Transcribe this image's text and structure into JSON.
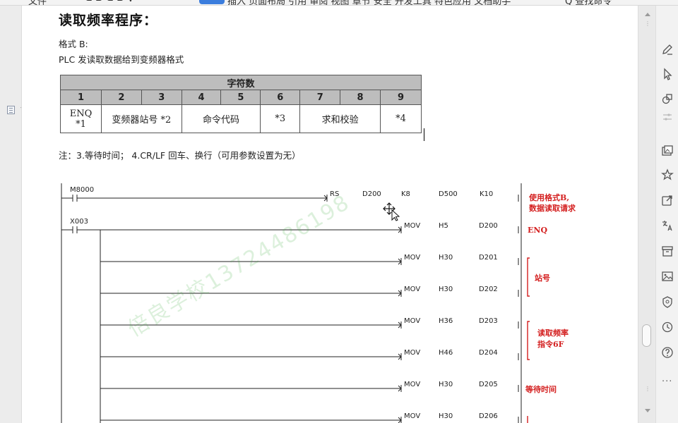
{
  "toolbar": {
    "items": [
      "文件",
      "⊂ ⊃ ⊂ ⊃ ∨",
      "开始",
      "插入  页面布局  引用  审阅  视图  章节  安全  开发工具  特色应用  文档助手",
      "Q 查找命令"
    ]
  },
  "document": {
    "title": "读取频率程序：",
    "format_label": "格式 B:",
    "format_desc": "PLC 发读取数据给到变频器格式",
    "note": "注：3.等待时间；    4.CR/LF 回车、换行（可用参数设置为无）",
    "frame_table": {
      "header": "字符数",
      "numbers": [
        "1",
        "2",
        "3",
        "4",
        "5",
        "6",
        "7",
        "8",
        "9"
      ],
      "values": {
        "enq": "ENQ",
        "enq_note": "*1",
        "station": "变频器站号",
        "station_note": "*2",
        "command": "命令代码",
        "wait": "*3",
        "checksum": "求和校验",
        "crlf": "*4"
      }
    },
    "watermark": "倍良学校13724486198"
  },
  "ladder": {
    "rungs": [
      {
        "contact": "M8000",
        "instruction": "RS",
        "op1": "D200",
        "op2": "K8",
        "op3": "D500",
        "op4": "K10",
        "comment": [
          "使用格式B,",
          "数据读取请求"
        ]
      },
      {
        "contact": "X003",
        "instruction": "MOV",
        "op1": "H5",
        "op2": "D200",
        "comment": [
          "ENQ"
        ]
      },
      {
        "instruction": "MOV",
        "op1": "H30",
        "op2": "D201"
      },
      {
        "instruction": "MOV",
        "op1": "H30",
        "op2": "D202",
        "comment": [
          "站号"
        ]
      },
      {
        "instruction": "MOV",
        "op1": "H36",
        "op2": "D203"
      },
      {
        "instruction": "MOV",
        "op1": "H46",
        "op2": "D204",
        "comment": [
          "读取频率",
          "指令6F"
        ]
      },
      {
        "instruction": "MOV",
        "op1": "H30",
        "op2": "D205",
        "comment": [
          "等待时间"
        ]
      },
      {
        "instruction": "MOV",
        "op1": "H30",
        "op2": "D206"
      }
    ]
  },
  "side_tools": [
    "pen-icon",
    "pointer-icon",
    "shapes-icon",
    "sliders-icon",
    "image-gallery-icon",
    "star-icon",
    "share-icon",
    "translate-icon",
    "archive-icon",
    "picture-icon",
    "shield-icon",
    "history-icon",
    "help-icon"
  ],
  "colors": {
    "annotation_red": "#d42020",
    "table_header_gray": "#bdbdbd",
    "accent_blue": "#3b7ddd"
  }
}
